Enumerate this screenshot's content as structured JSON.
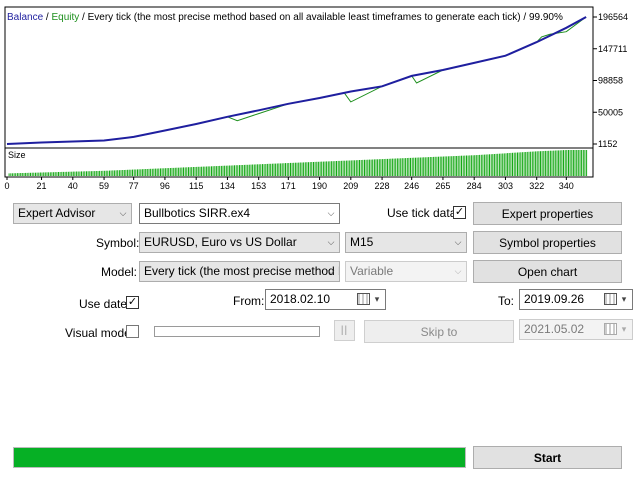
{
  "chart": {
    "legend": {
      "balance": "Balance",
      "separator1": " / ",
      "equity": "Equity",
      "separator2": " / ",
      "description": "Every tick (the most precise method based on all available least timeframes to generate each tick)",
      "separator3": " / ",
      "quality": "99.90%"
    },
    "size_label": "Size",
    "colors": {
      "balance": "#1f1f9f",
      "equity": "#1d8f1d",
      "size_bars": "#16a816",
      "axis": "#000000"
    }
  },
  "chart_data": {
    "type": "line",
    "y_ticks": [
      "196564",
      "147711",
      "98858",
      "50005",
      "1152"
    ],
    "x_ticks": [
      "0",
      "21",
      "40",
      "59",
      "77",
      "96",
      "115",
      "134",
      "153",
      "171",
      "190",
      "209",
      "228",
      "246",
      "265",
      "284",
      "303",
      "322",
      "340"
    ],
    "x_range": [
      0,
      355
    ],
    "y_range": [
      1152,
      196564
    ],
    "series": [
      {
        "name": "Balance",
        "x": [
          0,
          21,
          40,
          59,
          77,
          96,
          115,
          134,
          153,
          171,
          190,
          209,
          228,
          246,
          265,
          284,
          303,
          322,
          340,
          352
        ],
        "y": [
          1152,
          3500,
          5000,
          6500,
          12000,
          22000,
          32000,
          43000,
          53000,
          63000,
          72000,
          82000,
          90000,
          106000,
          115000,
          126000,
          137000,
          158000,
          180000,
          196564
        ]
      },
      {
        "name": "Equity",
        "x": [
          0,
          21,
          40,
          59,
          77,
          96,
          115,
          134,
          140,
          153,
          171,
          190,
          205,
          209,
          228,
          246,
          249,
          265,
          284,
          303,
          322,
          325,
          330,
          340,
          352
        ],
        "y": [
          1152,
          3500,
          5000,
          6500,
          12000,
          22000,
          32000,
          43000,
          37000,
          48000,
          63000,
          72000,
          80000,
          66000,
          90000,
          106000,
          95000,
          115000,
          126000,
          137000,
          158000,
          166000,
          170000,
          174000,
          196564
        ]
      },
      {
        "name": "Size",
        "x": [
          0,
          59,
          96,
          134,
          171,
          209,
          246,
          284,
          322,
          340,
          352
        ],
        "y": [
          0.1,
          0.2,
          0.3,
          0.4,
          0.5,
          0.6,
          0.7,
          0.8,
          0.95,
          1.0,
          1.0
        ]
      }
    ]
  },
  "form": {
    "type_select": "Expert Advisor",
    "expert_select": "Bullbotics SIRR.ex4",
    "use_tick_data_label": "Use tick data",
    "use_tick_data_checked": "✓",
    "expert_properties": "Expert properties",
    "symbol_label": "Symbol:",
    "symbol_select": "EURUSD, Euro vs US Dollar",
    "period_select": "M15",
    "symbol_properties": "Symbol properties",
    "model_label": "Model:",
    "model_select": "Every tick (the most precise method b",
    "spread_select": "Variable",
    "open_chart": "Open chart",
    "use_date_label": "Use date",
    "use_date_checked": "✓",
    "from_label": "From:",
    "from_date": "2018.02.10",
    "to_label": "To:",
    "to_date": "2019.09.26",
    "visual_mode_label": "Visual mode",
    "pause_glyph": "||",
    "skip_to": "Skip to",
    "skip_date": "2021.05.02",
    "start": "Start",
    "progress_fraction": 1.0
  }
}
